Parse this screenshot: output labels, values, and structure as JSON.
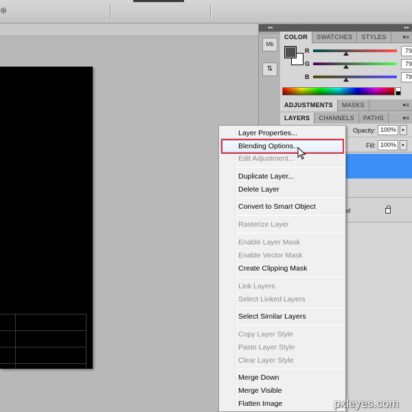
{
  "color_panel": {
    "tabs": [
      "COLOR",
      "SWATCHES",
      "STYLES"
    ],
    "r_label": "R",
    "r_value": "79",
    "g_label": "G",
    "g_value": "79",
    "b_label": "B",
    "b_value": "79",
    "foreground_color": "#4f4f4f",
    "background_color": "#ffffff"
  },
  "adjustments_panel": {
    "tabs": [
      "ADJUSTMENTS",
      "MASKS"
    ]
  },
  "layers_panel": {
    "tabs": [
      "LAYERS",
      "CHANNELS",
      "PATHS"
    ],
    "opacity_label": "Opacity:",
    "opacity_value": "100%",
    "fill_label": "Fill:",
    "fill_value": "100%",
    "background_layer_name_fragment": "nd",
    "selected_color": "#3b8ff5"
  },
  "context_menu": {
    "items": [
      {
        "label": "Layer Properties...",
        "enabled": true
      },
      {
        "label": "Blending Options...",
        "enabled": true,
        "hovered": true
      },
      {
        "label": "Edit Adjustment...",
        "enabled": false
      },
      {
        "label": "Duplicate Layer...",
        "enabled": true
      },
      {
        "label": "Delete Layer",
        "enabled": true
      },
      {
        "label": "Convert to Smart Object",
        "enabled": true
      },
      {
        "label": "Rasterize Layer",
        "enabled": false
      },
      {
        "label": "Enable Layer Mask",
        "enabled": false
      },
      {
        "label": "Enable Vector Mask",
        "enabled": false
      },
      {
        "label": "Create Clipping Mask",
        "enabled": true
      },
      {
        "label": "Link Layers",
        "enabled": false
      },
      {
        "label": "Select Linked Layers",
        "enabled": false
      },
      {
        "label": "Select Similar Layers",
        "enabled": true
      },
      {
        "label": "Copy Layer Style",
        "enabled": false
      },
      {
        "label": "Paste Layer Style",
        "enabled": false
      },
      {
        "label": "Clear Layer Style",
        "enabled": false
      },
      {
        "label": "Merge Down",
        "enabled": true
      },
      {
        "label": "Merge Visible",
        "enabled": true
      },
      {
        "label": "Flatten Image",
        "enabled": true
      }
    ],
    "highlight_color": "#e0303c"
  },
  "dock": {
    "collapse_glyph": "◂◂",
    "expand_glyph": "▸▸",
    "mini_bridge_label": "Mb"
  },
  "watermark": "pxleyes.com"
}
